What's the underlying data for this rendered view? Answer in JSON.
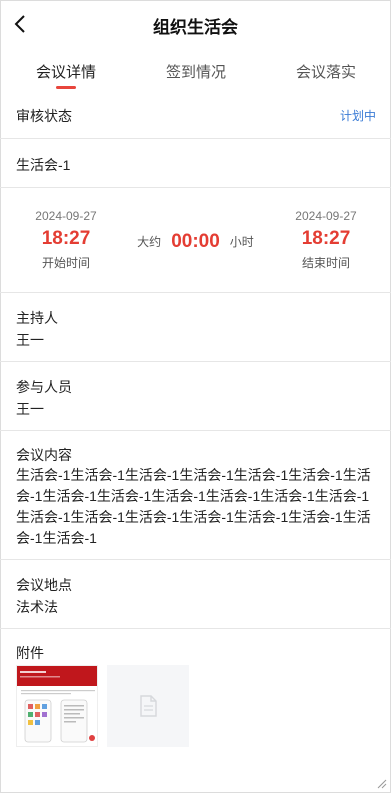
{
  "header": {
    "title": "组织生活会",
    "back_icon": "chevron-left-icon"
  },
  "tabs": [
    {
      "label": "会议详情",
      "active": true
    },
    {
      "label": "签到情况",
      "active": false
    },
    {
      "label": "会议落实",
      "active": false
    }
  ],
  "review": {
    "label": "审核状态",
    "status": "计划中"
  },
  "meeting_name": "生活会-1",
  "schedule": {
    "start_date": "2024-09-27",
    "start_time": "18:27",
    "start_label": "开始时间",
    "approx_label": "大约",
    "duration": "00:00",
    "duration_unit": "小时",
    "end_date": "2024-09-27",
    "end_time": "18:27",
    "end_label": "结束时间"
  },
  "host": {
    "label": "主持人",
    "value": "王一"
  },
  "participants": {
    "label": "参与人员",
    "value": "王一"
  },
  "content": {
    "label": "会议内容",
    "value": "生活会-1生活会-1生活会-1生活会-1生活会-1生活会-1生活会-1生活会-1生活会-1生活会-1生活会-1生活会-1生活会-1生活会-1生活会-1生活会-1生活会-1生活会-1生活会-1生活会-1生活会-1"
  },
  "location": {
    "label": "会议地点",
    "value": "法术法"
  },
  "attachments": {
    "label": "附件",
    "items": [
      "image-thumbnail",
      "file-icon"
    ]
  },
  "colors": {
    "accent": "#e43d33",
    "status": "#3a7bd5",
    "tab_indicator": "#e8453c"
  }
}
